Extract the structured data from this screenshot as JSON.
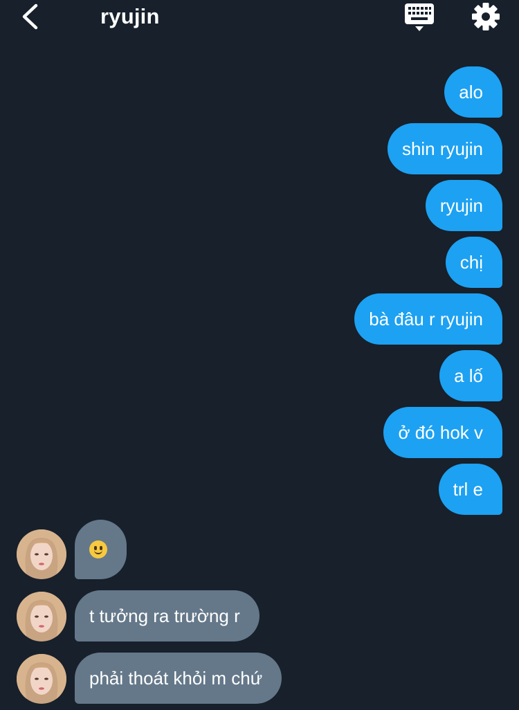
{
  "header": {
    "title": "ryujin",
    "back_icon": "chevron-left-icon",
    "keyboard_icon": "keyboard-icon",
    "settings_icon": "gear-icon"
  },
  "colors": {
    "background": "#17202b",
    "sent_bubble": "#1da1f2",
    "received_bubble": "#65788a",
    "text": "#ffffff"
  },
  "messages": {
    "sent": [
      "alo",
      "shin ryujin",
      "ryujin",
      "chị",
      "bà đâu r ryujin",
      "a lố",
      "ở đó hok v",
      "trl e"
    ],
    "received": [
      {
        "type": "emoji",
        "text": "",
        "emoji": "slightly-smiling-face-icon"
      },
      {
        "type": "text",
        "text": "t tưởng ra trường r"
      },
      {
        "type": "text",
        "text": "phải thoát khỏi m chứ"
      }
    ]
  }
}
